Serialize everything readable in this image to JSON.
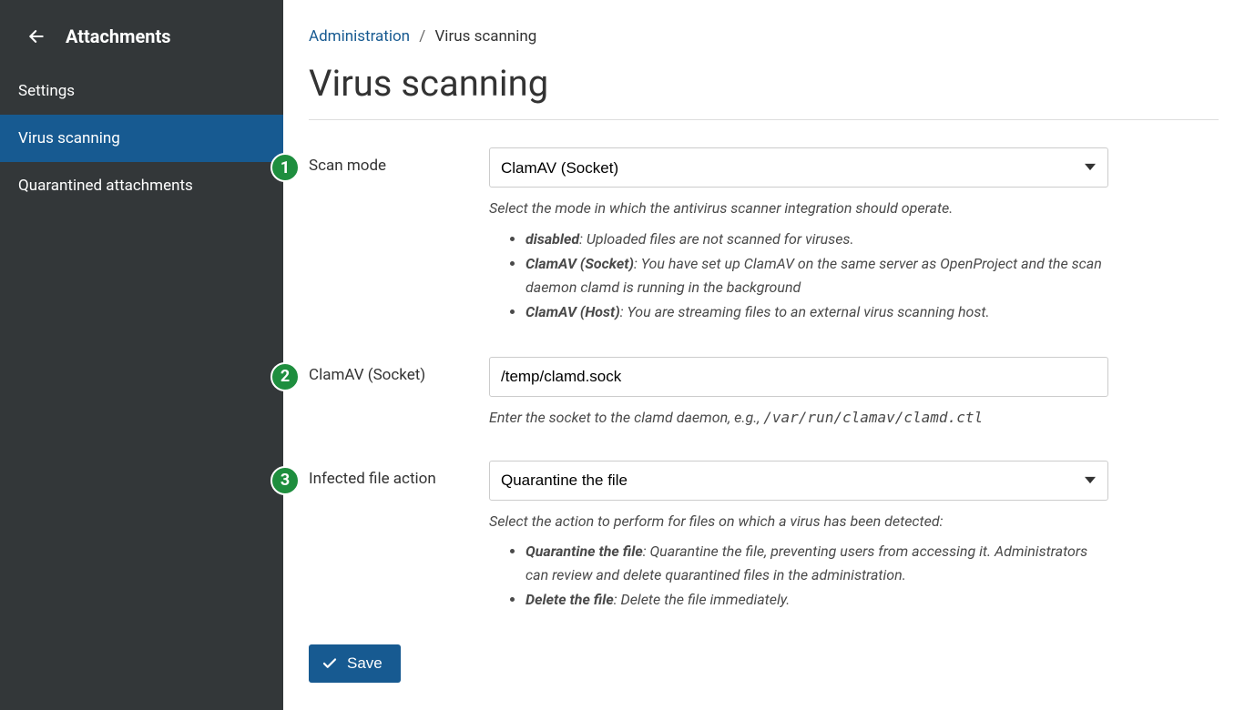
{
  "sidebar": {
    "title": "Attachments",
    "items": [
      {
        "label": "Settings",
        "active": false
      },
      {
        "label": "Virus scanning",
        "active": true
      },
      {
        "label": "Quarantined attachments",
        "active": false
      }
    ]
  },
  "breadcrumb": {
    "root": "Administration",
    "current": "Virus scanning"
  },
  "page": {
    "title": "Virus scanning"
  },
  "fields": {
    "scan_mode": {
      "label": "Scan mode",
      "value": "ClamAV (Socket)",
      "help_intro": "Select the mode in which the antivirus scanner integration should operate.",
      "options": [
        {
          "key": "disabled",
          "text": ": Uploaded files are not scanned for viruses."
        },
        {
          "key": "ClamAV (Socket)",
          "text": ": You have set up ClamAV on the same server as OpenProject and the scan daemon clamd is running in the background"
        },
        {
          "key": "ClamAV (Host)",
          "text": ": You are streaming files to an external virus scanning host."
        }
      ]
    },
    "clamav_socket": {
      "label": "ClamAV (Socket)",
      "value": "/temp/clamd.sock",
      "help_prefix": "Enter the socket to the clamd daemon, e.g., ",
      "help_example": "/var/run/clamav/clamd.ctl"
    },
    "infected_action": {
      "label": "Infected file action",
      "value": "Quarantine the file",
      "help_intro": "Select the action to perform for files on which a virus has been detected:",
      "options": [
        {
          "key": "Quarantine the file",
          "text": ": Quarantine the file, preventing users from accessing it. Administrators can review and delete quarantined files in the administration."
        },
        {
          "key": "Delete the file",
          "text": ": Delete the file immediately."
        }
      ]
    }
  },
  "buttons": {
    "save": "Save"
  },
  "annotations": {
    "b1": "1",
    "b2": "2",
    "b3": "3"
  }
}
